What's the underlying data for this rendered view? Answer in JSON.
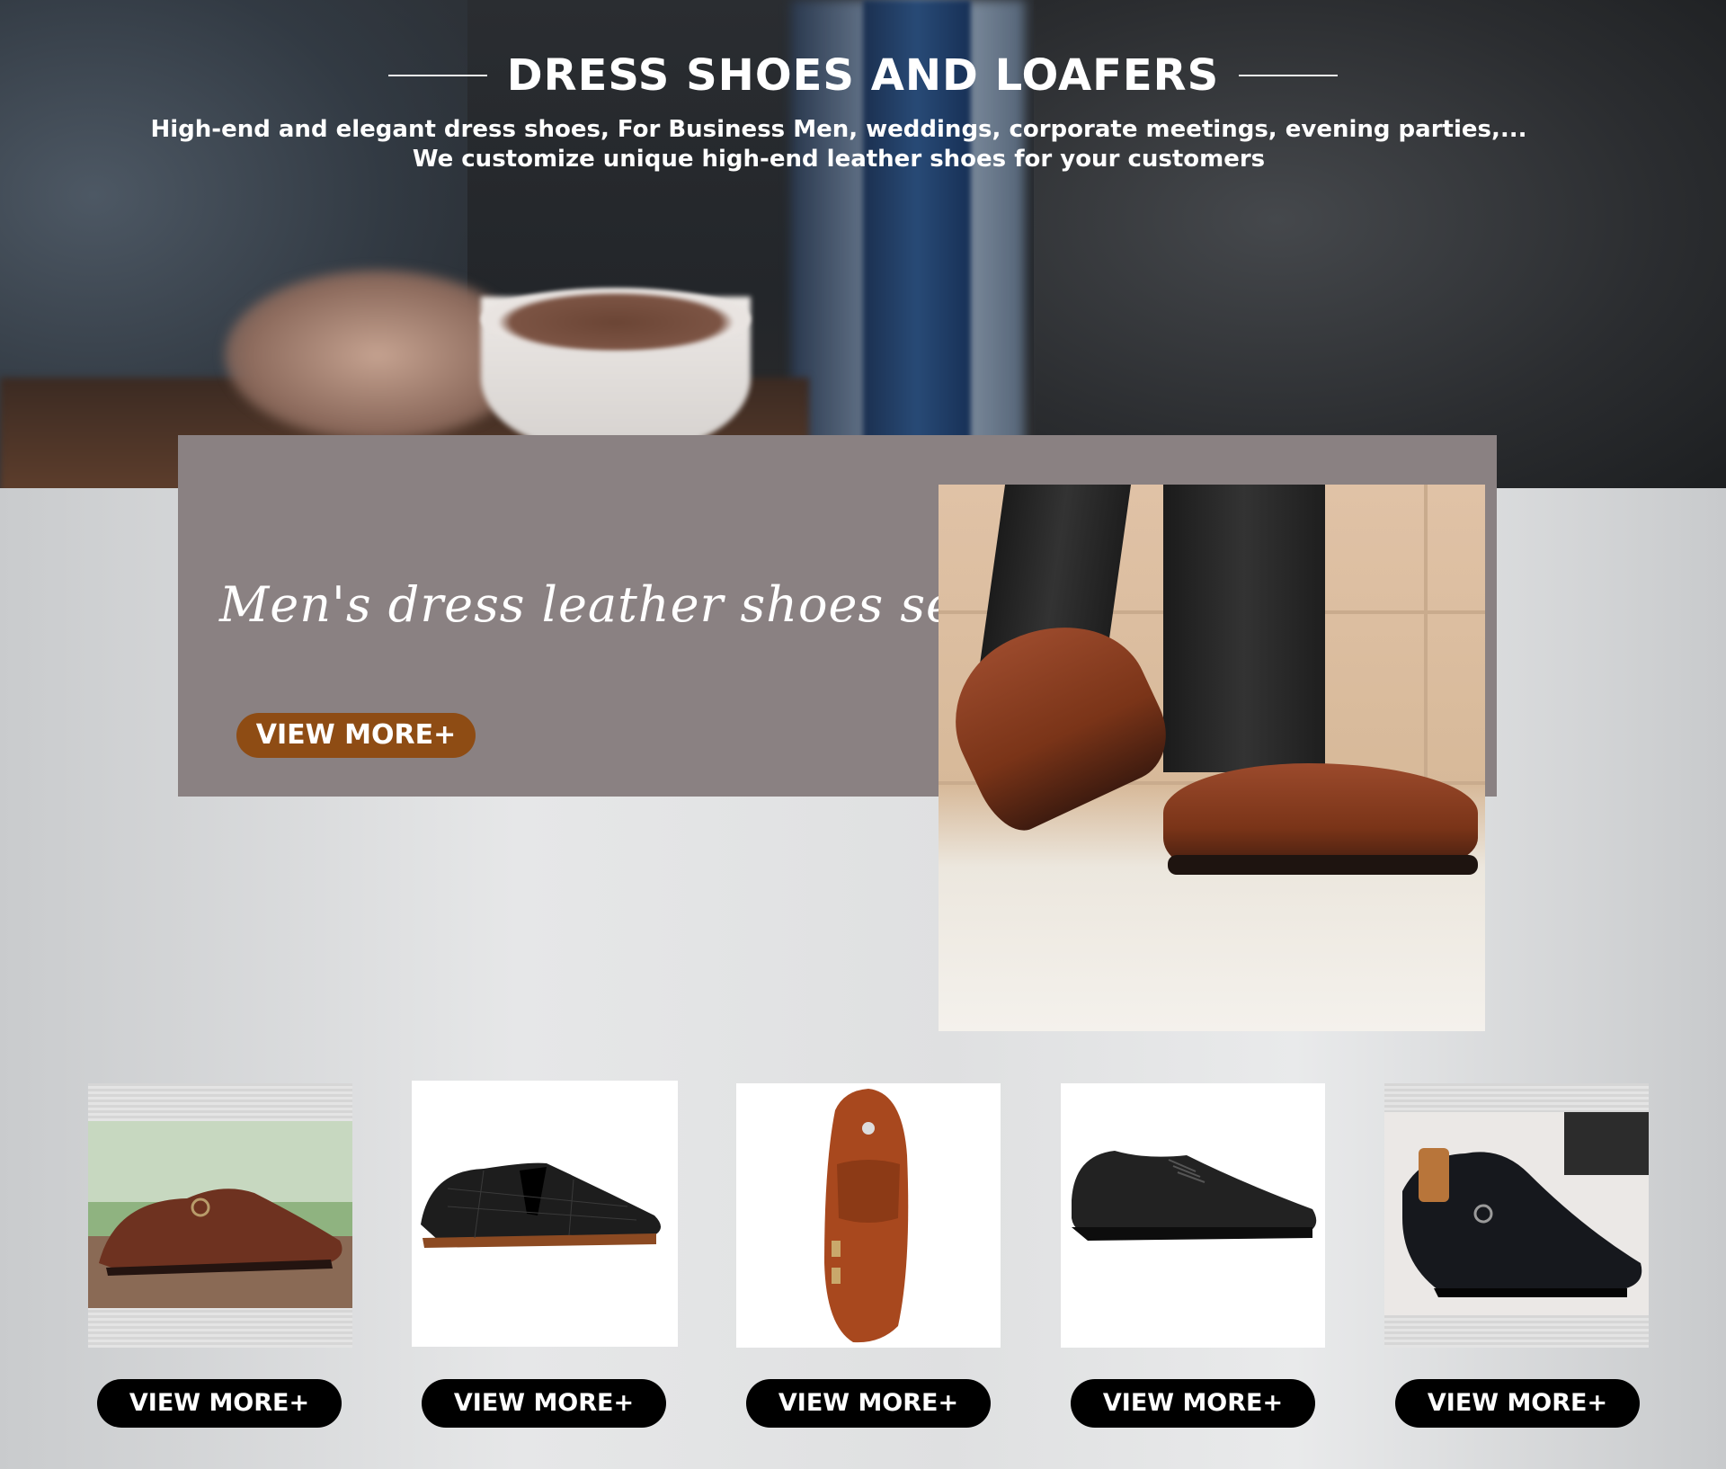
{
  "hero": {
    "title": "DRESS SHOES AND LOAFERS",
    "subtitle_line1": "High-end and elegant dress shoes, For Business Men,  weddings, corporate meetings, evening parties,...",
    "subtitle_line2": "We customize unique high-end leather shoes for your customers"
  },
  "feature": {
    "title": "Men's dress leather shoes series",
    "button_label": "VIEW MORE+",
    "button_color": "#8e4c14",
    "panel_color": "#8a8182"
  },
  "products": [
    {
      "button_label": "VIEW MORE+",
      "image": "brown-monk-strap-loafer-icon"
    },
    {
      "button_label": "VIEW MORE+",
      "image": "black-croc-tassel-loafer-icon"
    },
    {
      "button_label": "VIEW MORE+",
      "image": "tan-double-monk-loafer-icon"
    },
    {
      "button_label": "VIEW MORE+",
      "image": "black-oxford-shoe-icon"
    },
    {
      "button_label": "VIEW MORE+",
      "image": "black-monk-strap-loafer-icon"
    }
  ]
}
